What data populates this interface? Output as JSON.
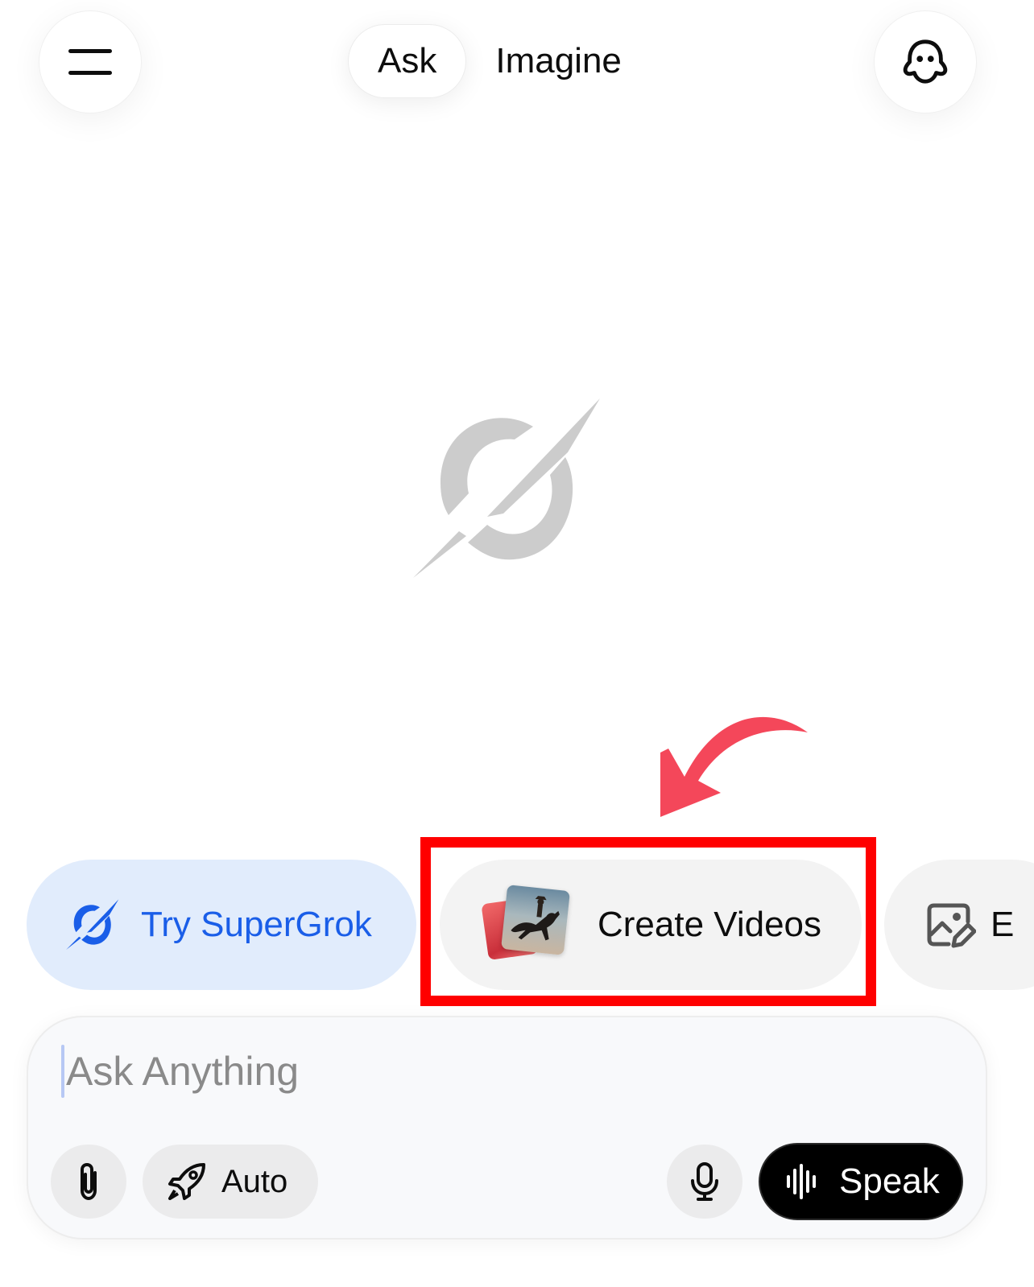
{
  "header": {
    "menu_icon": "hamburger-menu-icon",
    "tabs": [
      {
        "label": "Ask",
        "selected": true
      },
      {
        "label": "Imagine",
        "selected": false
      }
    ],
    "ghost_icon": "ghost-icon"
  },
  "center": {
    "logo_icon": "grok-logo-icon"
  },
  "chips": [
    {
      "label": "Try SuperGrok",
      "icon": "grok-logo-icon",
      "color": "#1a5ee8"
    },
    {
      "label": "Create Videos",
      "icon": "video-thumbnails"
    },
    {
      "label": "E",
      "icon": "image-edit-icon"
    }
  ],
  "annotation": {
    "box_color": "#ff0000",
    "arrow_color": "#f4475a"
  },
  "input": {
    "placeholder": "Ask Anything",
    "attach_icon": "paperclip-icon",
    "auto_label": "Auto",
    "auto_icon": "rocket-icon",
    "mic_icon": "microphone-icon",
    "speak_label": "Speak",
    "speak_icon": "waveform-icon"
  }
}
